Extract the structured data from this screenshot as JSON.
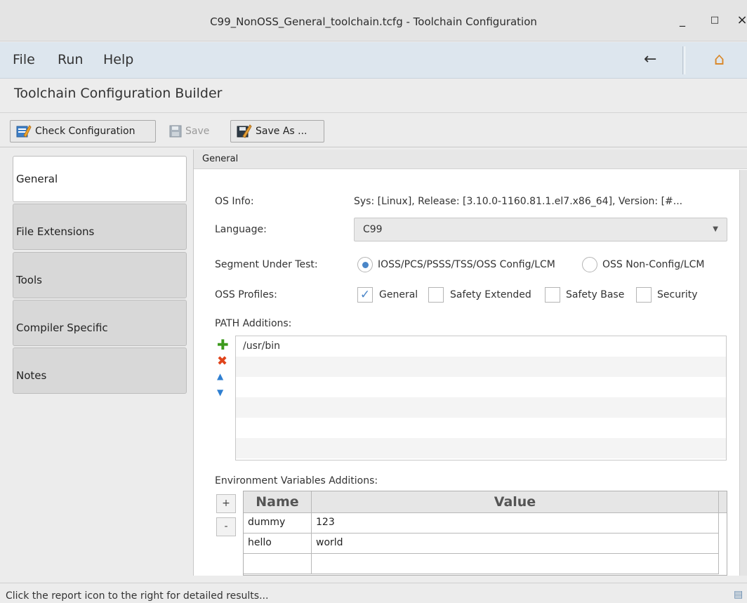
{
  "window": {
    "title": "C99_NonOSS_General_toolchain.tcfg - Toolchain Configuration",
    "minimize_glyph": "_",
    "maximize_glyph": "□",
    "close_glyph": "×"
  },
  "menu": {
    "items": [
      "File",
      "Run",
      "Help"
    ],
    "back_glyph": "←",
    "home_glyph": "⌂"
  },
  "heading": "Toolchain Configuration Builder",
  "toolbar": {
    "check_label": "Check Configuration",
    "save_label": "Save",
    "save_as_label": "Save As ..."
  },
  "side_tabs": [
    "General",
    "File Extensions",
    "Tools",
    "Compiler Specific",
    "Notes"
  ],
  "general": {
    "header": "General",
    "os_info_label": "OS Info:",
    "os_info_value": "Sys: [Linux], Release: [3.10.0-1160.81.1.el7.x86_64], Version: [#...",
    "language_label": "Language:",
    "language_value": "C99",
    "segment_label": "Segment Under Test:",
    "segment_options": [
      "IOSS/PCS/PSSS/TSS/OSS Config/LCM",
      "OSS Non-Config/LCM"
    ],
    "segment_selected": 0,
    "profiles_label": "OSS Profiles:",
    "profiles": [
      {
        "label": "General",
        "checked": true
      },
      {
        "label": "Safety Extended",
        "checked": false
      },
      {
        "label": "Safety Base",
        "checked": false
      },
      {
        "label": "Security",
        "checked": false
      }
    ],
    "path_label": "PATH Additions:",
    "paths": [
      "/usr/bin"
    ],
    "env_label": "Environment Variables Additions:",
    "env_add_label": "+",
    "env_remove_label": "-",
    "env_columns": [
      "Name",
      "Value"
    ],
    "env_rows": [
      {
        "name": "dummy",
        "value": "123"
      },
      {
        "name": "hello",
        "value": "world"
      }
    ]
  },
  "status": {
    "message": "Click the report icon to the right for detailed results...",
    "report_glyph": "▤"
  },
  "colors": {
    "accent": "#4a86c8",
    "add_icon": "#3c9a1c",
    "remove_icon": "#e0441b",
    "move_icon": "#2f7fd1"
  },
  "icons": {
    "path_add": "plus-icon",
    "path_remove": "x-icon",
    "path_up": "chevron-up-icon",
    "path_down": "chevron-down-icon"
  }
}
